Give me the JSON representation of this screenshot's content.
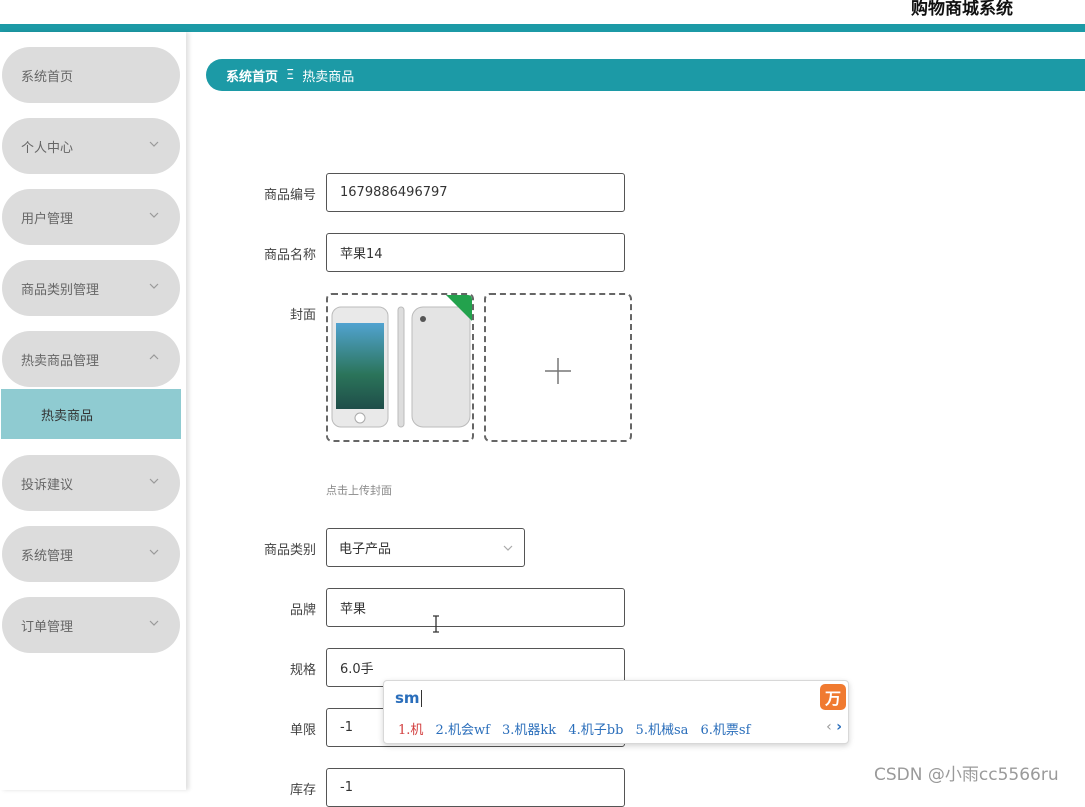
{
  "app": {
    "title": "购物商城系统"
  },
  "colors": {
    "accent": "#1c9aa6",
    "menu_bg": "#dcdcdc",
    "active_submenu": "#8fcbd1"
  },
  "sidebar": {
    "items": [
      {
        "label": "系统首页",
        "icon": "none"
      },
      {
        "label": "个人中心",
        "icon": "chevron-down-icon"
      },
      {
        "label": "用户管理",
        "icon": "chevron-down-icon"
      },
      {
        "label": "商品类别管理",
        "icon": "chevron-down-icon"
      },
      {
        "label": "热卖商品管理",
        "icon": "chevron-up-icon"
      },
      {
        "label": "投诉建议",
        "icon": "chevron-down-icon"
      },
      {
        "label": "系统管理",
        "icon": "chevron-down-icon"
      },
      {
        "label": "订单管理",
        "icon": "chevron-down-icon"
      }
    ],
    "submenu": {
      "label": "热卖商品"
    }
  },
  "breadcrumb": {
    "home": "系统首页",
    "separator": "Ξ",
    "current": "热卖商品"
  },
  "form": {
    "product_code": {
      "label": "商品编号",
      "value": "1679886496797"
    },
    "product_name": {
      "label": "商品名称",
      "value": "苹果14"
    },
    "cover": {
      "label": "封面",
      "hint": "点击上传封面"
    },
    "category": {
      "label": "商品类别",
      "value": "电子产品"
    },
    "brand": {
      "label": "品牌",
      "value": "苹果"
    },
    "spec": {
      "label": "规格",
      "value": "6.0手"
    },
    "limit": {
      "label": "单限",
      "value": "-1"
    },
    "stock": {
      "label": "库存",
      "value": "-1"
    }
  },
  "ime": {
    "pinyin": "sm",
    "logo": "万",
    "candidates": [
      "1.机",
      "2.机会wf",
      "3.机器kk",
      "4.机子bb",
      "5.机械sa",
      "6.机票sf"
    ],
    "nav": {
      "prev": "‹",
      "next": "›"
    }
  },
  "watermark": "CSDN @小雨cc5566ru"
}
